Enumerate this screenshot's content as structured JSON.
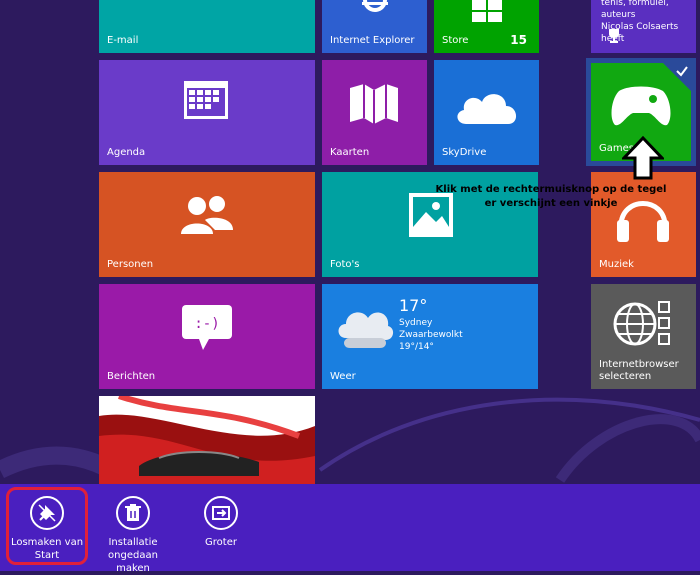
{
  "tiles": {
    "mail": {
      "label": "E-mail",
      "color": "#00a5a5"
    },
    "ie": {
      "label": "Internet Explorer",
      "color": "#2d5fd0"
    },
    "store": {
      "label": "Store",
      "badge": "15",
      "color": "#00a300"
    },
    "people_feed": {
      "line1": "tenis, formulei, auteurs",
      "line2": "Nicolas Colsaerts heeft",
      "color": "#5a2fc0"
    },
    "agenda": {
      "label": "Agenda",
      "color": "#6a3bc9"
    },
    "kaarten": {
      "label": "Kaarten",
      "color": "#8e1ea8"
    },
    "skydrive": {
      "label": "SkyDrive",
      "color": "#1a6fd6"
    },
    "games": {
      "label": "Games",
      "color": "#11a811"
    },
    "personen": {
      "label": "Personen",
      "color": "#d65323"
    },
    "fotos": {
      "label": "Foto's",
      "color": "#00a1a1"
    },
    "muziek": {
      "label": "Muziek",
      "color": "#e25a2a"
    },
    "berichten": {
      "label": "Berichten",
      "color": "#9a1aa8"
    },
    "weer": {
      "label": "Weer",
      "temp": "17°",
      "city": "Sydney",
      "condition": "Zwaarbewolkt",
      "range": "19°/14°",
      "color": "#1a7fe0"
    },
    "browser": {
      "label": "Internetbrowser selecteren",
      "color": "#5a5a5a"
    }
  },
  "annotation": {
    "line1": "Klik met de rechtermuisknop op de tegel",
    "line2": "er verschijnt een vinkje"
  },
  "appbar": {
    "unpin": "Losmaken van Start",
    "uninstall": "Installatie ongedaan maken",
    "larger": "Groter"
  }
}
